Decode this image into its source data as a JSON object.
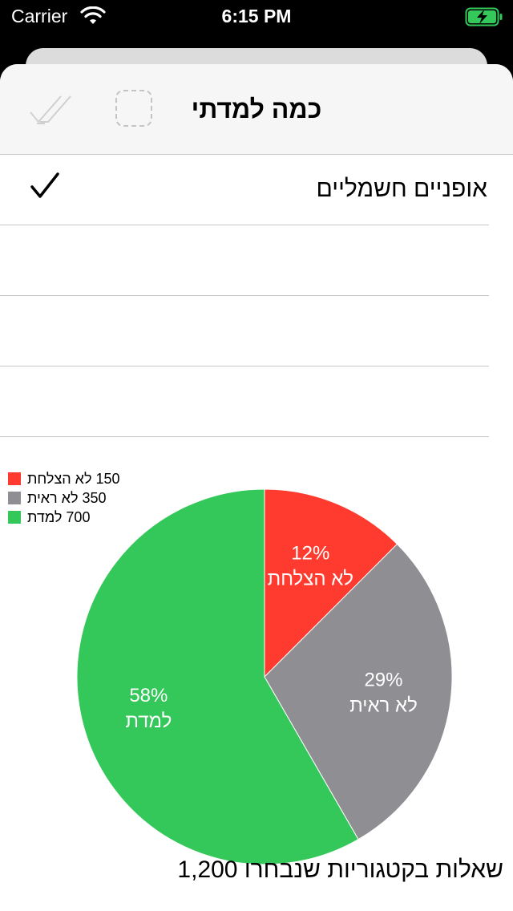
{
  "status_bar": {
    "carrier": "Carrier",
    "time": "6:15 PM"
  },
  "nav": {
    "title": "כמה למדתי",
    "left_icons": [
      "double-check-icon",
      "dashed-square-icon"
    ]
  },
  "list": {
    "rows": [
      {
        "label": "אופניים חשמליים",
        "checked": true
      },
      {
        "label": "",
        "checked": false
      },
      {
        "label": "",
        "checked": false
      },
      {
        "label": "",
        "checked": false
      }
    ]
  },
  "legend": [
    {
      "text": "150 לא הצלחת",
      "color": "#ff3b30"
    },
    {
      "text": "350 לא ראית",
      "color": "#8e8e93"
    },
    {
      "text": "700 למדת",
      "color": "#34c759"
    }
  ],
  "chart_data": {
    "type": "pie",
    "categories": [
      "לא הצלחת",
      "לא ראית",
      "למדת"
    ],
    "values": [
      150,
      350,
      700
    ],
    "percent_labels": [
      "12%",
      "29%",
      "58%"
    ],
    "colors": [
      "#ff3b30",
      "#8e8e93",
      "#34c759"
    ],
    "legend_position": "top-left",
    "total_label": "1,200 שאלות בקטגוריות שנבחרו"
  }
}
